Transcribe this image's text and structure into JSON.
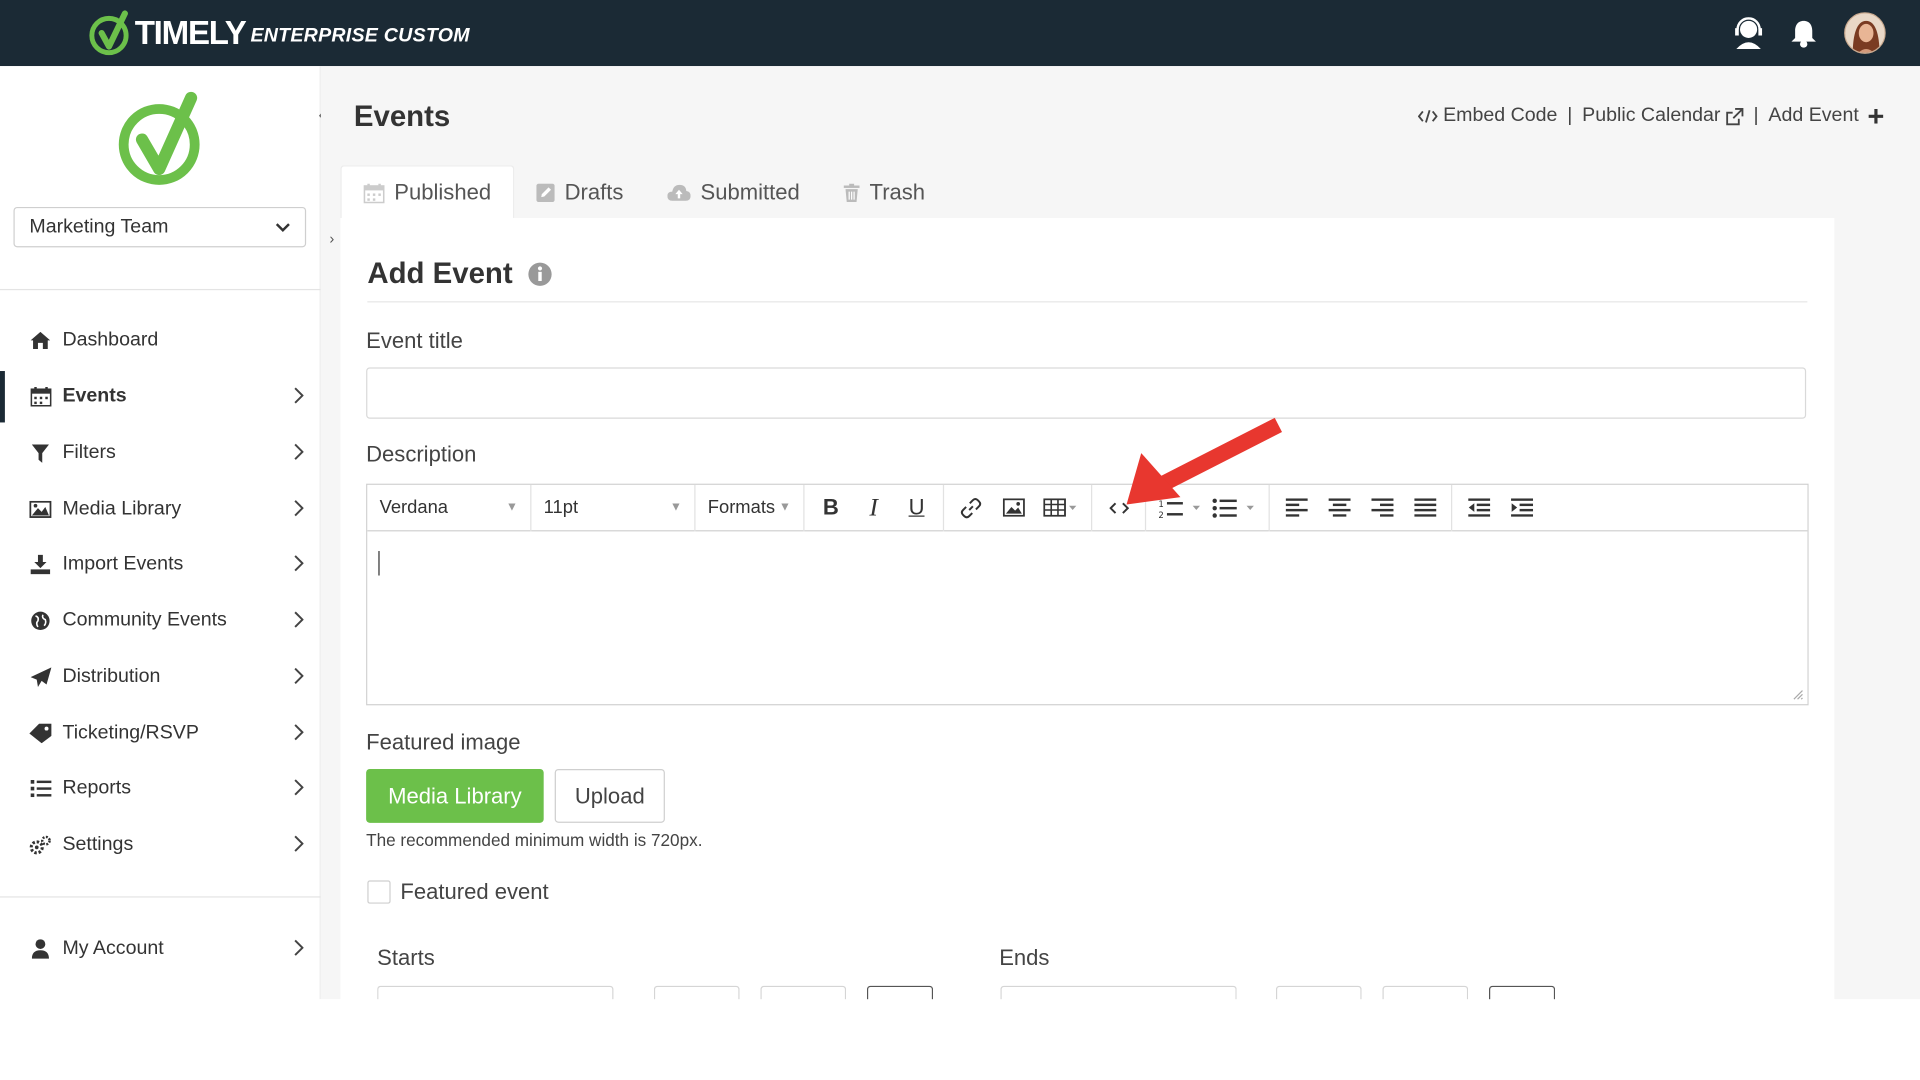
{
  "brand": {
    "name": "TIMELY",
    "edition": "ENTERPRISE CUSTOM"
  },
  "sidebar": {
    "team": "Marketing Team",
    "items": [
      {
        "label": "Dashboard",
        "icon": "home-icon"
      },
      {
        "label": "Events",
        "icon": "calendar-icon",
        "active": true
      },
      {
        "label": "Filters",
        "icon": "filter-icon"
      },
      {
        "label": "Media Library",
        "icon": "image-icon"
      },
      {
        "label": "Import Events",
        "icon": "download-icon"
      },
      {
        "label": "Community Events",
        "icon": "globe-icon"
      },
      {
        "label": "Distribution",
        "icon": "paper-plane-icon"
      },
      {
        "label": "Ticketing/RSVP",
        "icon": "ticket-icon"
      },
      {
        "label": "Reports",
        "icon": "list-icon"
      },
      {
        "label": "Settings",
        "icon": "gears-icon"
      }
    ],
    "account": {
      "label": "My Account",
      "icon": "user-icon"
    }
  },
  "header": {
    "title": "Events",
    "links": {
      "embed": "Embed Code",
      "public": "Public Calendar",
      "add": "Add Event"
    },
    "separator": "|"
  },
  "tabs": [
    {
      "label": "Published",
      "icon": "calendar-icon"
    },
    {
      "label": "Drafts",
      "icon": "edit-icon"
    },
    {
      "label": "Submitted",
      "icon": "cloud-upload-icon"
    },
    {
      "label": "Trash",
      "icon": "trash-icon"
    }
  ],
  "form": {
    "heading": "Add Event",
    "event_title_label": "Event title",
    "event_title_value": "",
    "description_label": "Description",
    "toolbar": {
      "font": "Verdana",
      "size": "11pt",
      "formats": "Formats"
    },
    "featured_image_label": "Featured image",
    "media_library_button": "Media Library",
    "upload_button": "Upload",
    "hint": "The recommended minimum width is 720px.",
    "featured_event_label": "Featured event",
    "featured_event_checked": false,
    "starts_label": "Starts",
    "ends_label": "Ends"
  },
  "colors": {
    "topbar": "#1b2a35",
    "brand_green": "#6cc04a",
    "annotation_arrow": "#e8372f"
  }
}
